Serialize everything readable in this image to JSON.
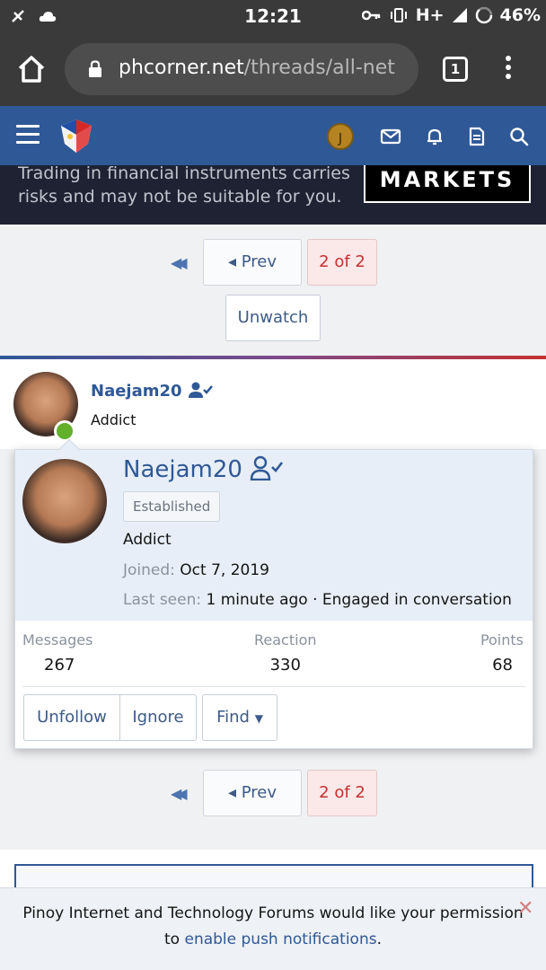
{
  "status_bar": {
    "time": "12:21",
    "network": "H+",
    "battery": "46%"
  },
  "browser": {
    "url_host": "phcorner.net",
    "url_path": "/threads/all-net",
    "tab_count": "1"
  },
  "header": {
    "user_initial": "J",
    "icons": [
      "menu-icon",
      "site-logo",
      "avatar",
      "envelope-icon",
      "bell-icon",
      "document-icon",
      "search-icon"
    ]
  },
  "ad": {
    "line1": "Trading in financial instruments carries",
    "line2": "risks and may not be suitable for you.",
    "brand": "MARKETS"
  },
  "pagination": {
    "prev_label": "Prev",
    "current_label": "2 of 2"
  },
  "unwatch_label": "Unwatch",
  "post": {
    "username": "Naejam20",
    "user_title": "Addict"
  },
  "member_card": {
    "username": "Naejam20",
    "badge": "Established",
    "user_title": "Addict",
    "joined_label": "Joined:",
    "joined_value": "Oct 7, 2019",
    "last_seen_label": "Last seen:",
    "last_seen_value": "1 minute ago · Engaged in conversation",
    "stats": [
      {
        "label": "Messages",
        "value": "267"
      },
      {
        "label": "Reaction",
        "value": "330"
      },
      {
        "label": "Points",
        "value": "68"
      }
    ],
    "buttons": {
      "unfollow": "Unfollow",
      "ignore": "Ignore",
      "find": "Find"
    }
  },
  "notice": {
    "text_before": "Pinoy Internet and Technology Forums would like your permission",
    "text_to": "to",
    "link": "enable push notifications",
    "text_after": "."
  },
  "colors": {
    "header_blue": "#2f5896",
    "online_green": "#63b02a",
    "current_page_red": "#c43232"
  }
}
